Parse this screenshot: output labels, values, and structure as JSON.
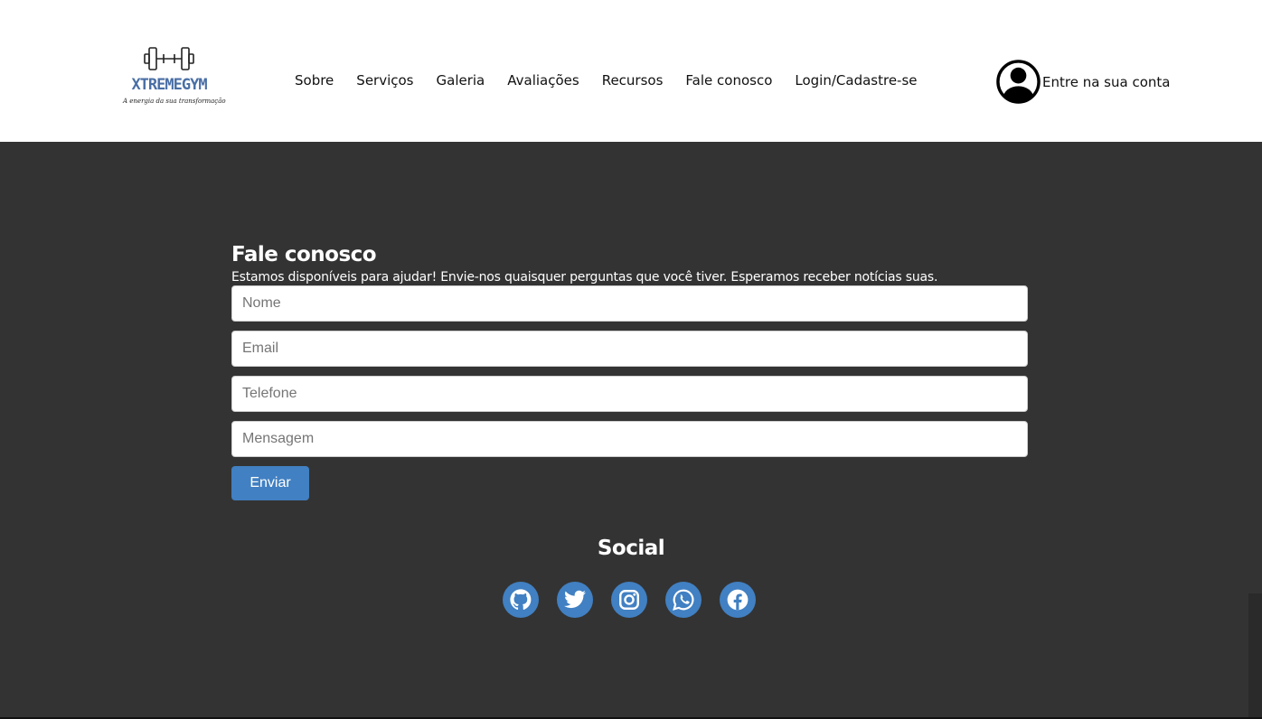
{
  "header": {
    "logo": {
      "brand": "XTREMEGYM",
      "tagline": "A energia da sua transformação"
    },
    "nav": [
      {
        "label": "Sobre"
      },
      {
        "label": "Serviços"
      },
      {
        "label": "Galeria"
      },
      {
        "label": "Avaliações"
      },
      {
        "label": "Recursos"
      },
      {
        "label": "Fale conosco"
      },
      {
        "label": "Login/Cadastre-se"
      }
    ],
    "account": {
      "label": "Entre na sua conta",
      "icon": "user-circle-icon"
    }
  },
  "contact": {
    "title": "Fale conosco",
    "subtitle": "Estamos disponíveis para ajudar! Envie-nos quaisquer perguntas que você tiver. Esperamos receber notícias suas.",
    "fields": {
      "name": {
        "placeholder": "Nome",
        "value": ""
      },
      "email": {
        "placeholder": "Email",
        "value": ""
      },
      "phone": {
        "placeholder": "Telefone",
        "value": ""
      },
      "message": {
        "placeholder": "Mensagem",
        "value": ""
      }
    },
    "submit_label": "Enviar"
  },
  "social": {
    "title": "Social",
    "icons": [
      "github-icon",
      "twitter-icon",
      "instagram-icon",
      "whatsapp-icon",
      "facebook-icon"
    ]
  },
  "colors": {
    "header_bg": "#ffffff",
    "page_bg": "#333333",
    "accent": "#4180c2",
    "logo_text": "#4a6fa5"
  }
}
